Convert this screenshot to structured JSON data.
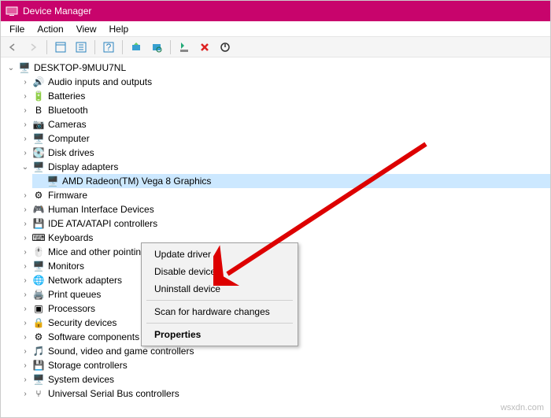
{
  "window": {
    "title": "Device Manager"
  },
  "menu": {
    "file": "File",
    "action": "Action",
    "view": "View",
    "help": "Help"
  },
  "root": {
    "name": "DESKTOP-9MUU7NL"
  },
  "categories": [
    {
      "id": "audio",
      "label": "Audio inputs and outputs",
      "expanded": false
    },
    {
      "id": "batteries",
      "label": "Batteries",
      "expanded": false
    },
    {
      "id": "bluetooth",
      "label": "Bluetooth",
      "expanded": false
    },
    {
      "id": "cameras",
      "label": "Cameras",
      "expanded": false
    },
    {
      "id": "computer",
      "label": "Computer",
      "expanded": false
    },
    {
      "id": "diskdrives",
      "label": "Disk drives",
      "expanded": false
    },
    {
      "id": "display",
      "label": "Display adapters",
      "expanded": true,
      "children": [
        {
          "id": "amdgpu",
          "label": "AMD Radeon(TM) Vega 8 Graphics",
          "selected": true
        }
      ]
    },
    {
      "id": "firmware",
      "label": "Firmware",
      "expanded": false
    },
    {
      "id": "hid",
      "label": "Human Interface Devices",
      "expanded": false,
      "truncated": "Human Interface Devi"
    },
    {
      "id": "ide",
      "label": "IDE ATA/ATAPI controllers",
      "expanded": false,
      "truncated": "IDE ATA/ATAPI controll"
    },
    {
      "id": "keyboards",
      "label": "Keyboards",
      "expanded": false
    },
    {
      "id": "mice",
      "label": "Mice and other pointing devices",
      "expanded": false,
      "truncated": "Mice and other point"
    },
    {
      "id": "monitors",
      "label": "Monitors",
      "expanded": false
    },
    {
      "id": "network",
      "label": "Network adapters",
      "expanded": false
    },
    {
      "id": "printqueues",
      "label": "Print queues",
      "expanded": false
    },
    {
      "id": "processors",
      "label": "Processors",
      "expanded": false
    },
    {
      "id": "security",
      "label": "Security devices",
      "expanded": false
    },
    {
      "id": "swcomp",
      "label": "Software components",
      "expanded": false
    },
    {
      "id": "sound",
      "label": "Sound, video and game controllers",
      "expanded": false
    },
    {
      "id": "storage",
      "label": "Storage controllers",
      "expanded": false
    },
    {
      "id": "system",
      "label": "System devices",
      "expanded": false
    },
    {
      "id": "usb",
      "label": "Universal Serial Bus controllers",
      "expanded": false
    }
  ],
  "contextMenu": {
    "updateDriver": "Update driver",
    "disableDevice": "Disable device",
    "uninstallDevice": "Uninstall device",
    "scanHardware": "Scan for hardware changes",
    "properties": "Properties"
  },
  "watermark": "wsxdn.com",
  "icons": {
    "audio": "🔊",
    "batteries": "🔋",
    "bluetooth": "B",
    "cameras": "📷",
    "computer": "🖥️",
    "diskdrives": "💽",
    "display": "🖥️",
    "firmware": "⚙",
    "hid": "🎮",
    "ide": "💾",
    "keyboards": "⌨",
    "mice": "🖱️",
    "monitors": "🖥️",
    "network": "🌐",
    "printqueues": "🖨️",
    "processors": "▣",
    "security": "🔒",
    "swcomp": "⚙",
    "sound": "🎵",
    "storage": "💾",
    "system": "🖥️",
    "usb": "⑂",
    "amdgpu": "🖥️",
    "root": "🖥️"
  }
}
